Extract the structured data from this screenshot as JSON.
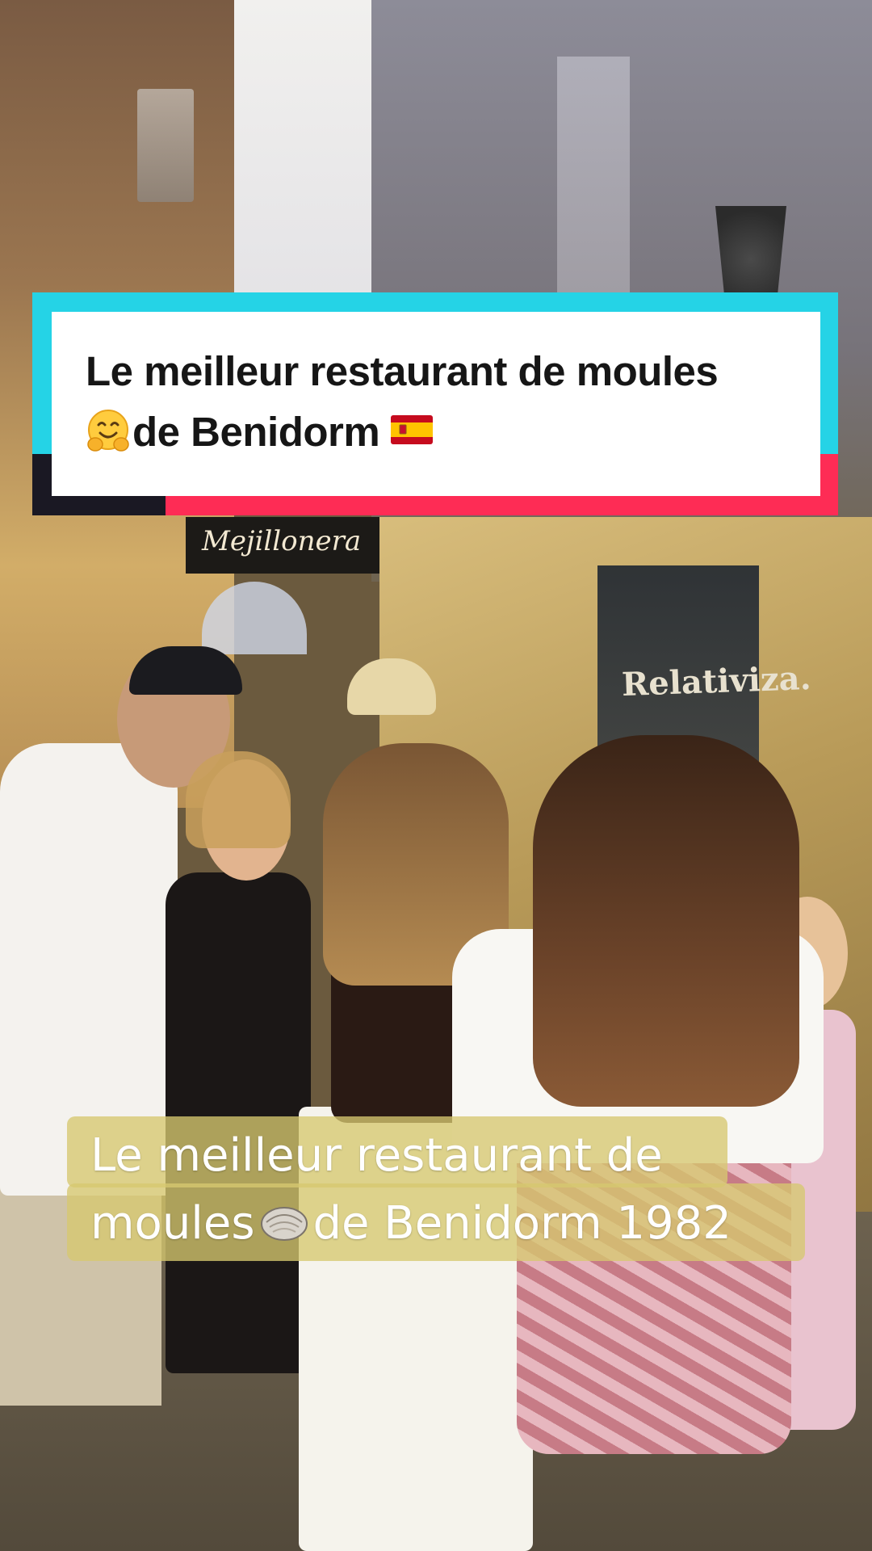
{
  "overlay": {
    "title_line1": "Le meilleur restaurant de moules",
    "title_line2": "de Benidorm",
    "title_emoji_before_line2": "hugging-face-emoji",
    "title_emoji_after_line2": "spain-flag-emoji",
    "caption_line1": "Le meilleur restaurant de",
    "caption_line2_start": "moules",
    "caption_line2_end": "de Benidorm 1982",
    "caption_emoji": "oyster-emoji"
  },
  "scene": {
    "sign_text": "Relativiza.",
    "awning_text": "Mejillonera"
  },
  "colors": {
    "card_cyan": "#25d3e6",
    "card_red": "#fe2c55",
    "card_dark": "#1a1823",
    "caption_bg": "#d6c870"
  }
}
